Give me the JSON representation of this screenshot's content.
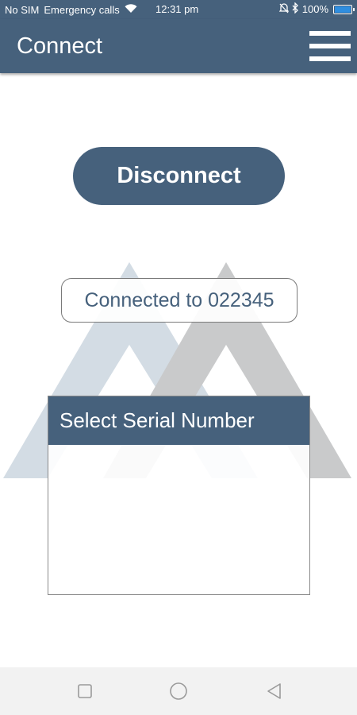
{
  "status_bar": {
    "carrier": "No SIM",
    "emergency": "Emergency calls",
    "time": "12:31 pm",
    "battery": "100%",
    "icons": [
      "wifi-icon",
      "mute-icon",
      "bluetooth-icon",
      "battery-icon"
    ]
  },
  "app_bar": {
    "title": "Connect",
    "menu_icon": "hamburger-menu-icon"
  },
  "main": {
    "disconnect_label": "Disconnect",
    "connection_status": "Connected to 022345"
  },
  "serial_list": {
    "header": "Select Serial Number",
    "items": []
  },
  "nav_bar": {
    "icons": [
      "recents-square-icon",
      "home-circle-icon",
      "back-triangle-icon"
    ]
  },
  "colors": {
    "primary": "#46617c",
    "background": "#ffffff",
    "watermark_light": "#d3dce4",
    "watermark_dark": "#c9cacb",
    "nav_background": "#f2f2f2",
    "battery": "#2f8ee0"
  }
}
